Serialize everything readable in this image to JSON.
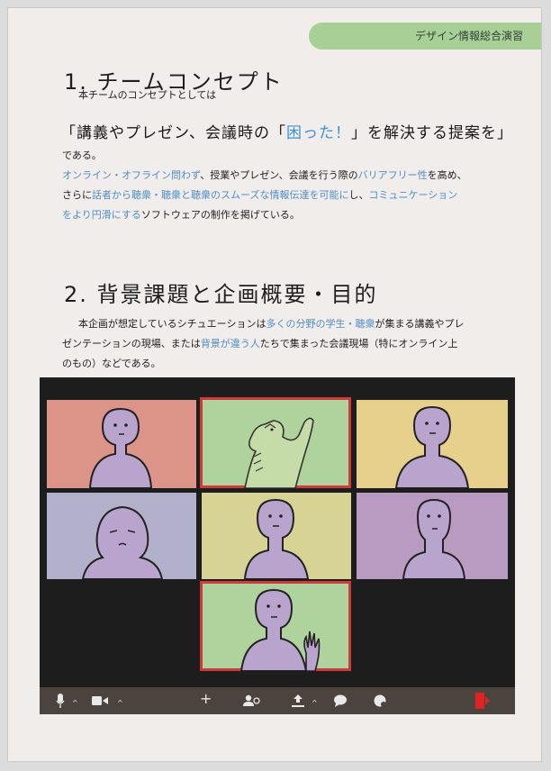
{
  "header": {
    "tab_label": "デザイン情報総合演習"
  },
  "section1": {
    "title": "1. チームコンセプト",
    "intro": "本チームのコンセプトとしては",
    "quote": {
      "before": "「講義やプレゼン、会議時の「",
      "highlight": "困った！",
      "after": "」を解決する提案を」"
    },
    "line_a": "である。",
    "line_b": {
      "hl1": "オンライン・オフライン問わず",
      "t1": "、授業やプレゼン、会議を行う際の",
      "hl2": "バリアフリー性",
      "t2": "を高め、"
    },
    "line_c": {
      "t1": "さらに",
      "hl1": "話者から聴衆・聴衆と聴衆のスムーズな情報伝達を可能に",
      "t2": "し、",
      "hl2": "コミュニケーション"
    },
    "line_d": {
      "hl1": "をより円滑にする",
      "t1": "ソフトウェアの制作を掲げている。"
    }
  },
  "section2": {
    "title": "2. 背景課題と企画概要・目的",
    "line_a": {
      "t1": "本企画が想定しているシチュエーションは",
      "hl1": "多くの分野の学生・聴衆",
      "t2": "が集まる講義やプレ"
    },
    "line_b": {
      "t1": "ゼンテーションの現場、または",
      "hl1": "背景が違う人",
      "t2": "たちで集まった会議現場（特にオンライン上"
    },
    "line_c": "のもの）などである。"
  },
  "illustration": {
    "tile_colors": [
      "#dc9489",
      "#aed39c",
      "#e7cf8c",
      "#b3b0cb",
      "#d6d394",
      "#b99ac0",
      "#aed39c"
    ],
    "person_color": "#b8a4cc",
    "dino_color": "#c6dca8",
    "toolbar": {
      "mic_icon": "mic-icon",
      "caret": "^",
      "video_icon": "video-icon",
      "plus": "+",
      "participants_icon": "participants-icon",
      "share_icon": "share-icon",
      "chat_icon": "chat-icon",
      "reaction_icon": "reaction-icon",
      "leave_icon": "leave-icon"
    }
  }
}
